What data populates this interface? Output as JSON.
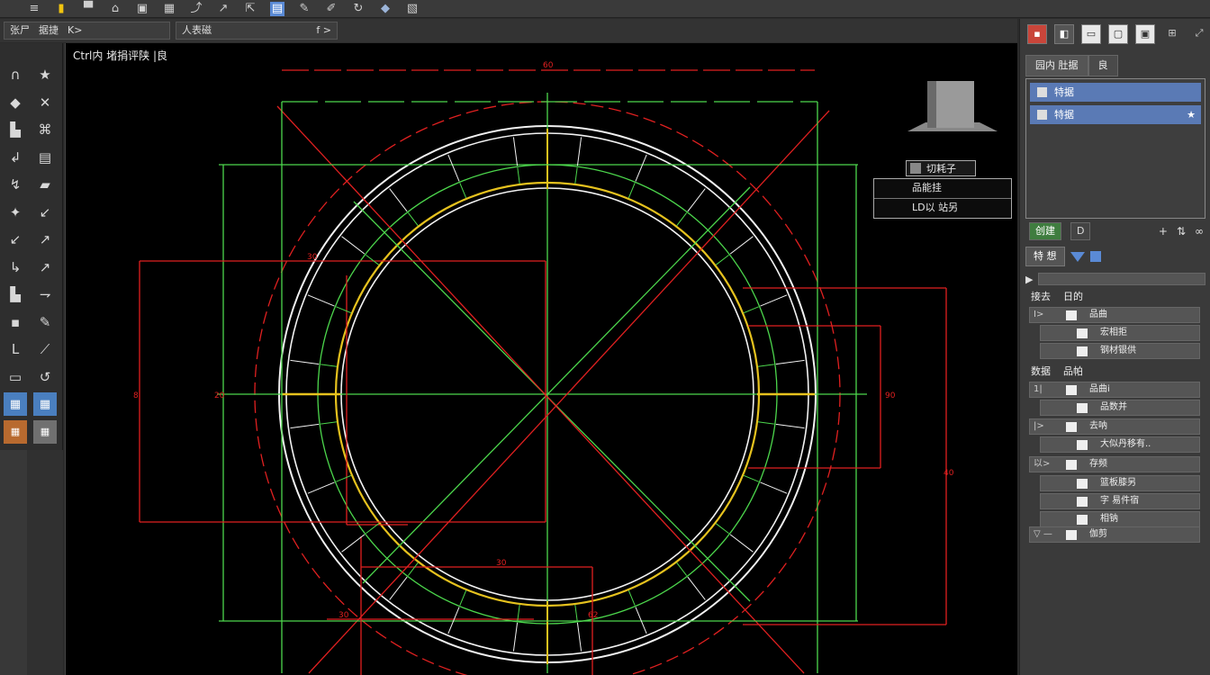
{
  "top_toolbar": {
    "icons": [
      "menu-icon",
      "lock-icon",
      "save-icon",
      "print-icon",
      "open-icon",
      "layer-icon",
      "pointer-icon",
      "arrow-icon",
      "cursor-icon",
      "palette-icon",
      "pen-icon",
      "pencil-icon",
      "refresh-icon",
      "shape-icon",
      "gallery-icon"
    ]
  },
  "sub_toolbar": {
    "combo1_label": "张尸",
    "combo1_value": "据捷",
    "combo1_suffix": "K>",
    "combo2_label": "人表磁",
    "combo2_suffix": "f >"
  },
  "tool_palette": {
    "tools": [
      "∩",
      "★",
      "◆",
      "✕",
      "▙",
      "⌘",
      "↲",
      "▤",
      "↯",
      "▰",
      "✦",
      "↙",
      "↙",
      "↗",
      "↳",
      "↗",
      "▙",
      "⇁",
      "▪",
      "✎",
      "L",
      "⟋",
      "▭",
      "↺",
      "▦",
      "▦",
      "▦",
      "▦"
    ]
  },
  "canvas": {
    "title": "Ctrl内 堵捐评陕 |良",
    "dim_labels": {
      "top": "60",
      "d1": "30",
      "d2": "8",
      "d3": "20",
      "d4": "90",
      "d5": "40",
      "d6": "30",
      "d7": "30",
      "d8": "62"
    },
    "colors": {
      "red": "#e02020",
      "green": "#4cd64c",
      "white": "#f2f2f2",
      "yellow": "#e6c21e"
    }
  },
  "nav_box": {
    "title": "切耗子",
    "rows": [
      "品能挂",
      "LD以 站另"
    ]
  },
  "right_panel": {
    "toolbar_icons": [
      "red-square-icon",
      "cube-icon",
      "window-icon",
      "frame-icon",
      "frame-alt-icon",
      "grid-icon",
      "expand-icon"
    ],
    "tabs": [
      "园内 肚据",
      "良"
    ],
    "layers": [
      {
        "label": "特据",
        "star": ""
      },
      {
        "label": "特据",
        "star": "★"
      }
    ],
    "layer_actions": {
      "green": "创建",
      "b2": "D",
      "plus": "+",
      "more": "⇅",
      "link": "∞"
    },
    "prop_tabs": {
      "t1": "特 想",
      "t2": ""
    },
    "prop_search_label": "▶",
    "categories": [
      {
        "label": "接去",
        "sub": "日的"
      },
      {
        "label": "数据",
        "sub": "品帕"
      }
    ],
    "rows": [
      {
        "key": "I>",
        "label": "品曲",
        "indent": false
      },
      {
        "key": "",
        "label": "宏相拒",
        "indent": true
      },
      {
        "key": "",
        "label": "钢材银供",
        "indent": true
      },
      {
        "key": "1|",
        "label": "品曲i",
        "indent": false
      },
      {
        "key": "",
        "label": "品数并",
        "indent": true
      },
      {
        "key": "|>",
        "label": "去呐",
        "indent": false
      },
      {
        "key": "",
        "label": "大似丹移有..",
        "indent": true
      },
      {
        "key": "以>",
        "label": "存频",
        "indent": false
      },
      {
        "key": "",
        "label": "篮板膝另",
        "indent": true
      },
      {
        "key": "",
        "label": "字 易件宿",
        "indent": true
      },
      {
        "key": "",
        "label": "相钠",
        "indent": true
      },
      {
        "key": "▽ —",
        "label": "伽剪",
        "indent": false
      }
    ]
  }
}
